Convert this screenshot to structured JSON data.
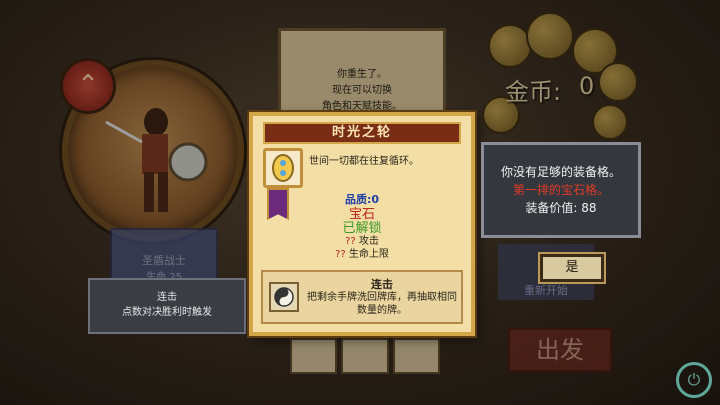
{
  "hero": {
    "name": "圣盾战士",
    "hp_label": "生命 25",
    "rank_icon": "chevron-rank-icon"
  },
  "scroll_note": {
    "lines": [
      "你重生了。",
      "现在可以切换",
      "角色和天赋技能。"
    ]
  },
  "left_desc": {
    "title": "连击",
    "text": "点数对决胜利时触发"
  },
  "card": {
    "title": "时光之轮",
    "flavor": "世间一切都在往复循环。",
    "quality": "品质:0",
    "type": "宝石",
    "status": "已解锁",
    "stat1_prefix": "??",
    "stat1": "攻击",
    "stat2_prefix": "??",
    "stat2": "生命上限",
    "ability_name": "连击",
    "ability_desc": "把剩余手牌洗回牌库，再抽取相同数量的牌。"
  },
  "gold": {
    "label": "金币:",
    "value": "0"
  },
  "alert": {
    "line1": "你没有足够的装备格。",
    "line2": "第一排的宝石格。",
    "line3": "装备价值: 88"
  },
  "buttons": {
    "yes": "是",
    "restart": "重新开始",
    "depart": "出发"
  },
  "colors": {
    "card_bg": "#f3dfa6",
    "title_bar": "#7a2d15",
    "quality_blue": "#1f3fa6",
    "gem_red": "#c0241a",
    "unlocked_green": "#3c9a2a",
    "alert_bg": "#34373d"
  }
}
